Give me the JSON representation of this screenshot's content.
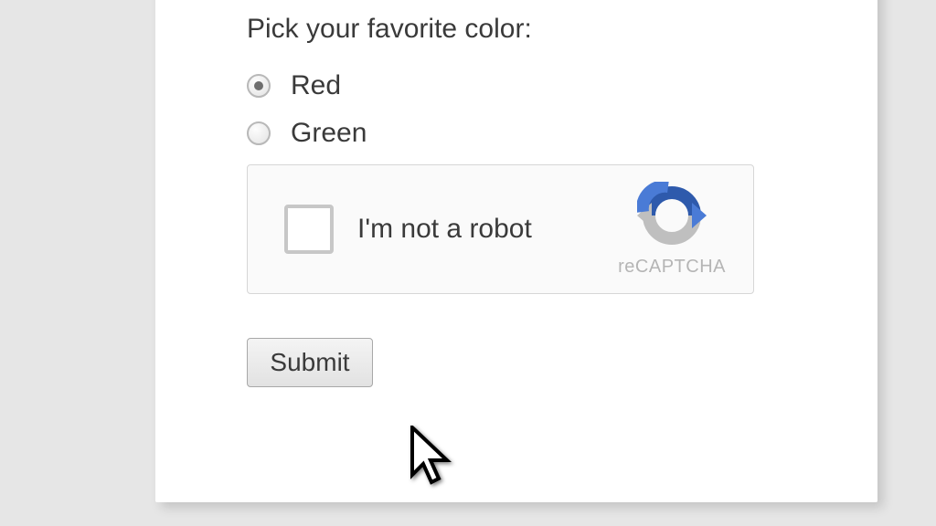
{
  "form": {
    "prompt": "Pick your favorite color:",
    "options": [
      {
        "label": "Red",
        "selected": true
      },
      {
        "label": "Green",
        "selected": false
      }
    ]
  },
  "recaptcha": {
    "label": "I'm not a robot",
    "brand": "reCAPTCHA"
  },
  "submit_label": "Submit"
}
